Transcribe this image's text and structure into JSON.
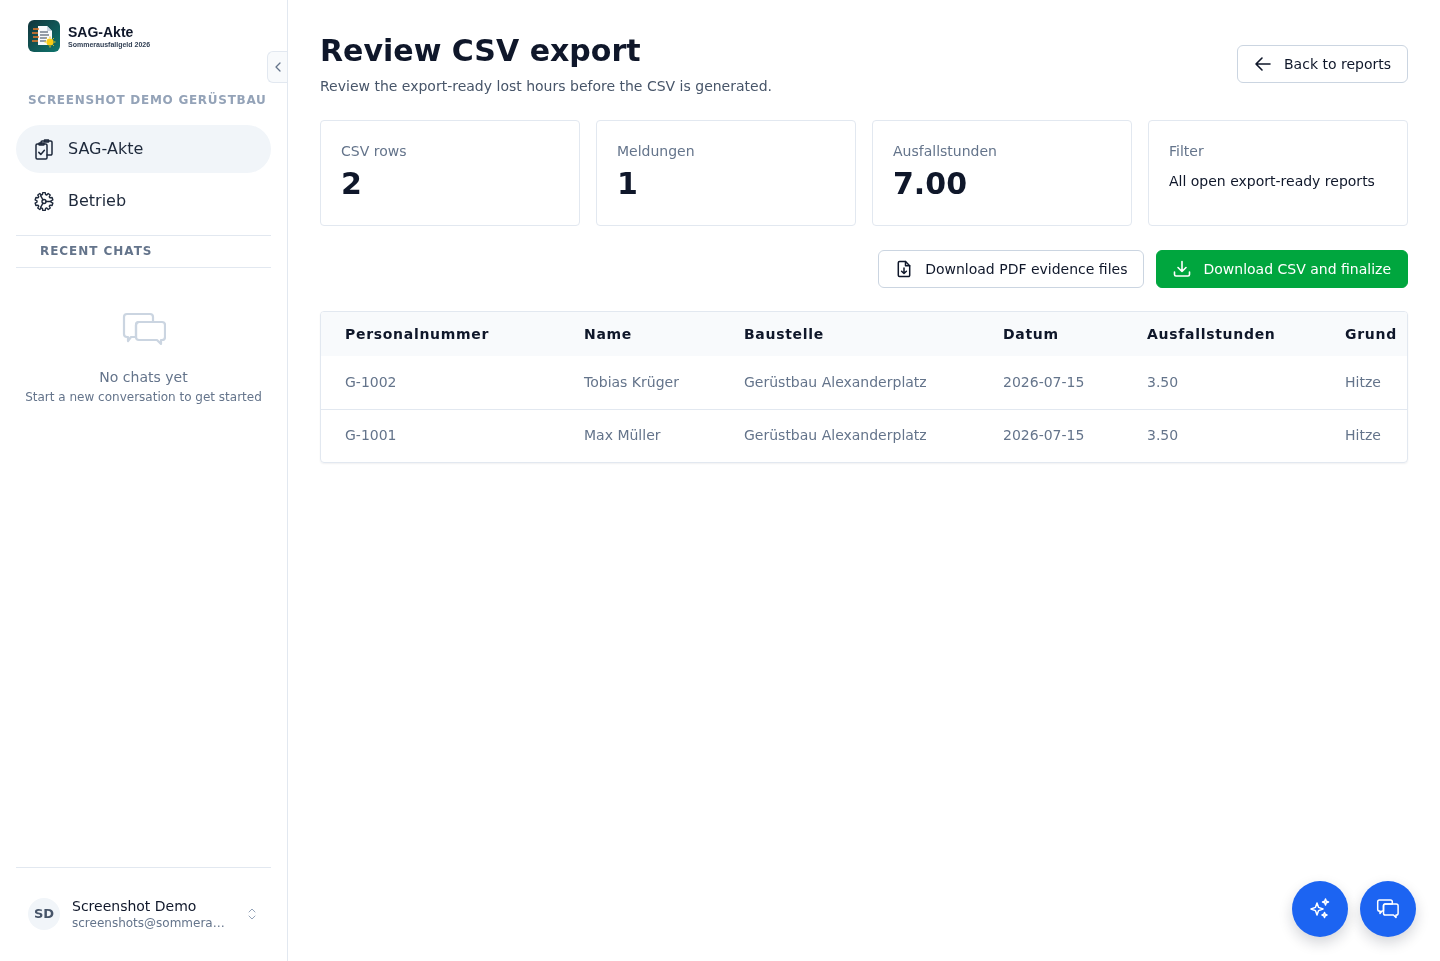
{
  "sidebar": {
    "brand": {
      "title": "SAG-Akte",
      "subtitle": "Sommerausfallgeld 2026"
    },
    "section_label": "SCREENSHOT DEMO GERÜSTBAU",
    "nav_items": [
      {
        "label": "SAG-Akte",
        "kind": "clipboard",
        "selected": true
      },
      {
        "label": "Betrieb",
        "kind": "gear",
        "selected": false
      }
    ],
    "recent_chats": {
      "heading": "RECENT CHATS",
      "empty_title": "No chats yet",
      "empty_text": "Start a new conversation to get started"
    },
    "user": {
      "initials": "SD",
      "name": "Screenshot Demo",
      "email": "screenshots@sommera…"
    }
  },
  "header": {
    "title": "Review CSV export",
    "subtitle": "Review the export-ready lost hours before the CSV is generated.",
    "back_button": "Back to reports"
  },
  "stats": [
    {
      "label": "CSV rows",
      "value": "2",
      "kind": "number"
    },
    {
      "label": "Meldungen",
      "value": "1",
      "kind": "number"
    },
    {
      "label": "Ausfallstunden",
      "value": "7.00",
      "kind": "number"
    },
    {
      "label": "Filter",
      "value": "All open export-ready reports",
      "kind": "text"
    }
  ],
  "actions": [
    {
      "label": "Download PDF evidence files",
      "kind": "outline"
    },
    {
      "label": "Download CSV and finalize",
      "kind": "primary"
    }
  ],
  "table": {
    "columns": [
      "Personalnummer",
      "Name",
      "Baustelle",
      "Datum",
      "Ausfallstunden",
      "Grund"
    ],
    "rows": [
      [
        "G-1002",
        "Tobias Krüger",
        "Gerüstbau Alexanderplatz",
        "2026-07-15",
        "3.50",
        "Hitze"
      ],
      [
        "G-1001",
        "Max Müller",
        "Gerüstbau Alexanderplatz",
        "2026-07-15",
        "3.50",
        "Hitze"
      ]
    ]
  },
  "floating_buttons": [
    {
      "kind": "sparkles"
    },
    {
      "kind": "chat"
    }
  ]
}
